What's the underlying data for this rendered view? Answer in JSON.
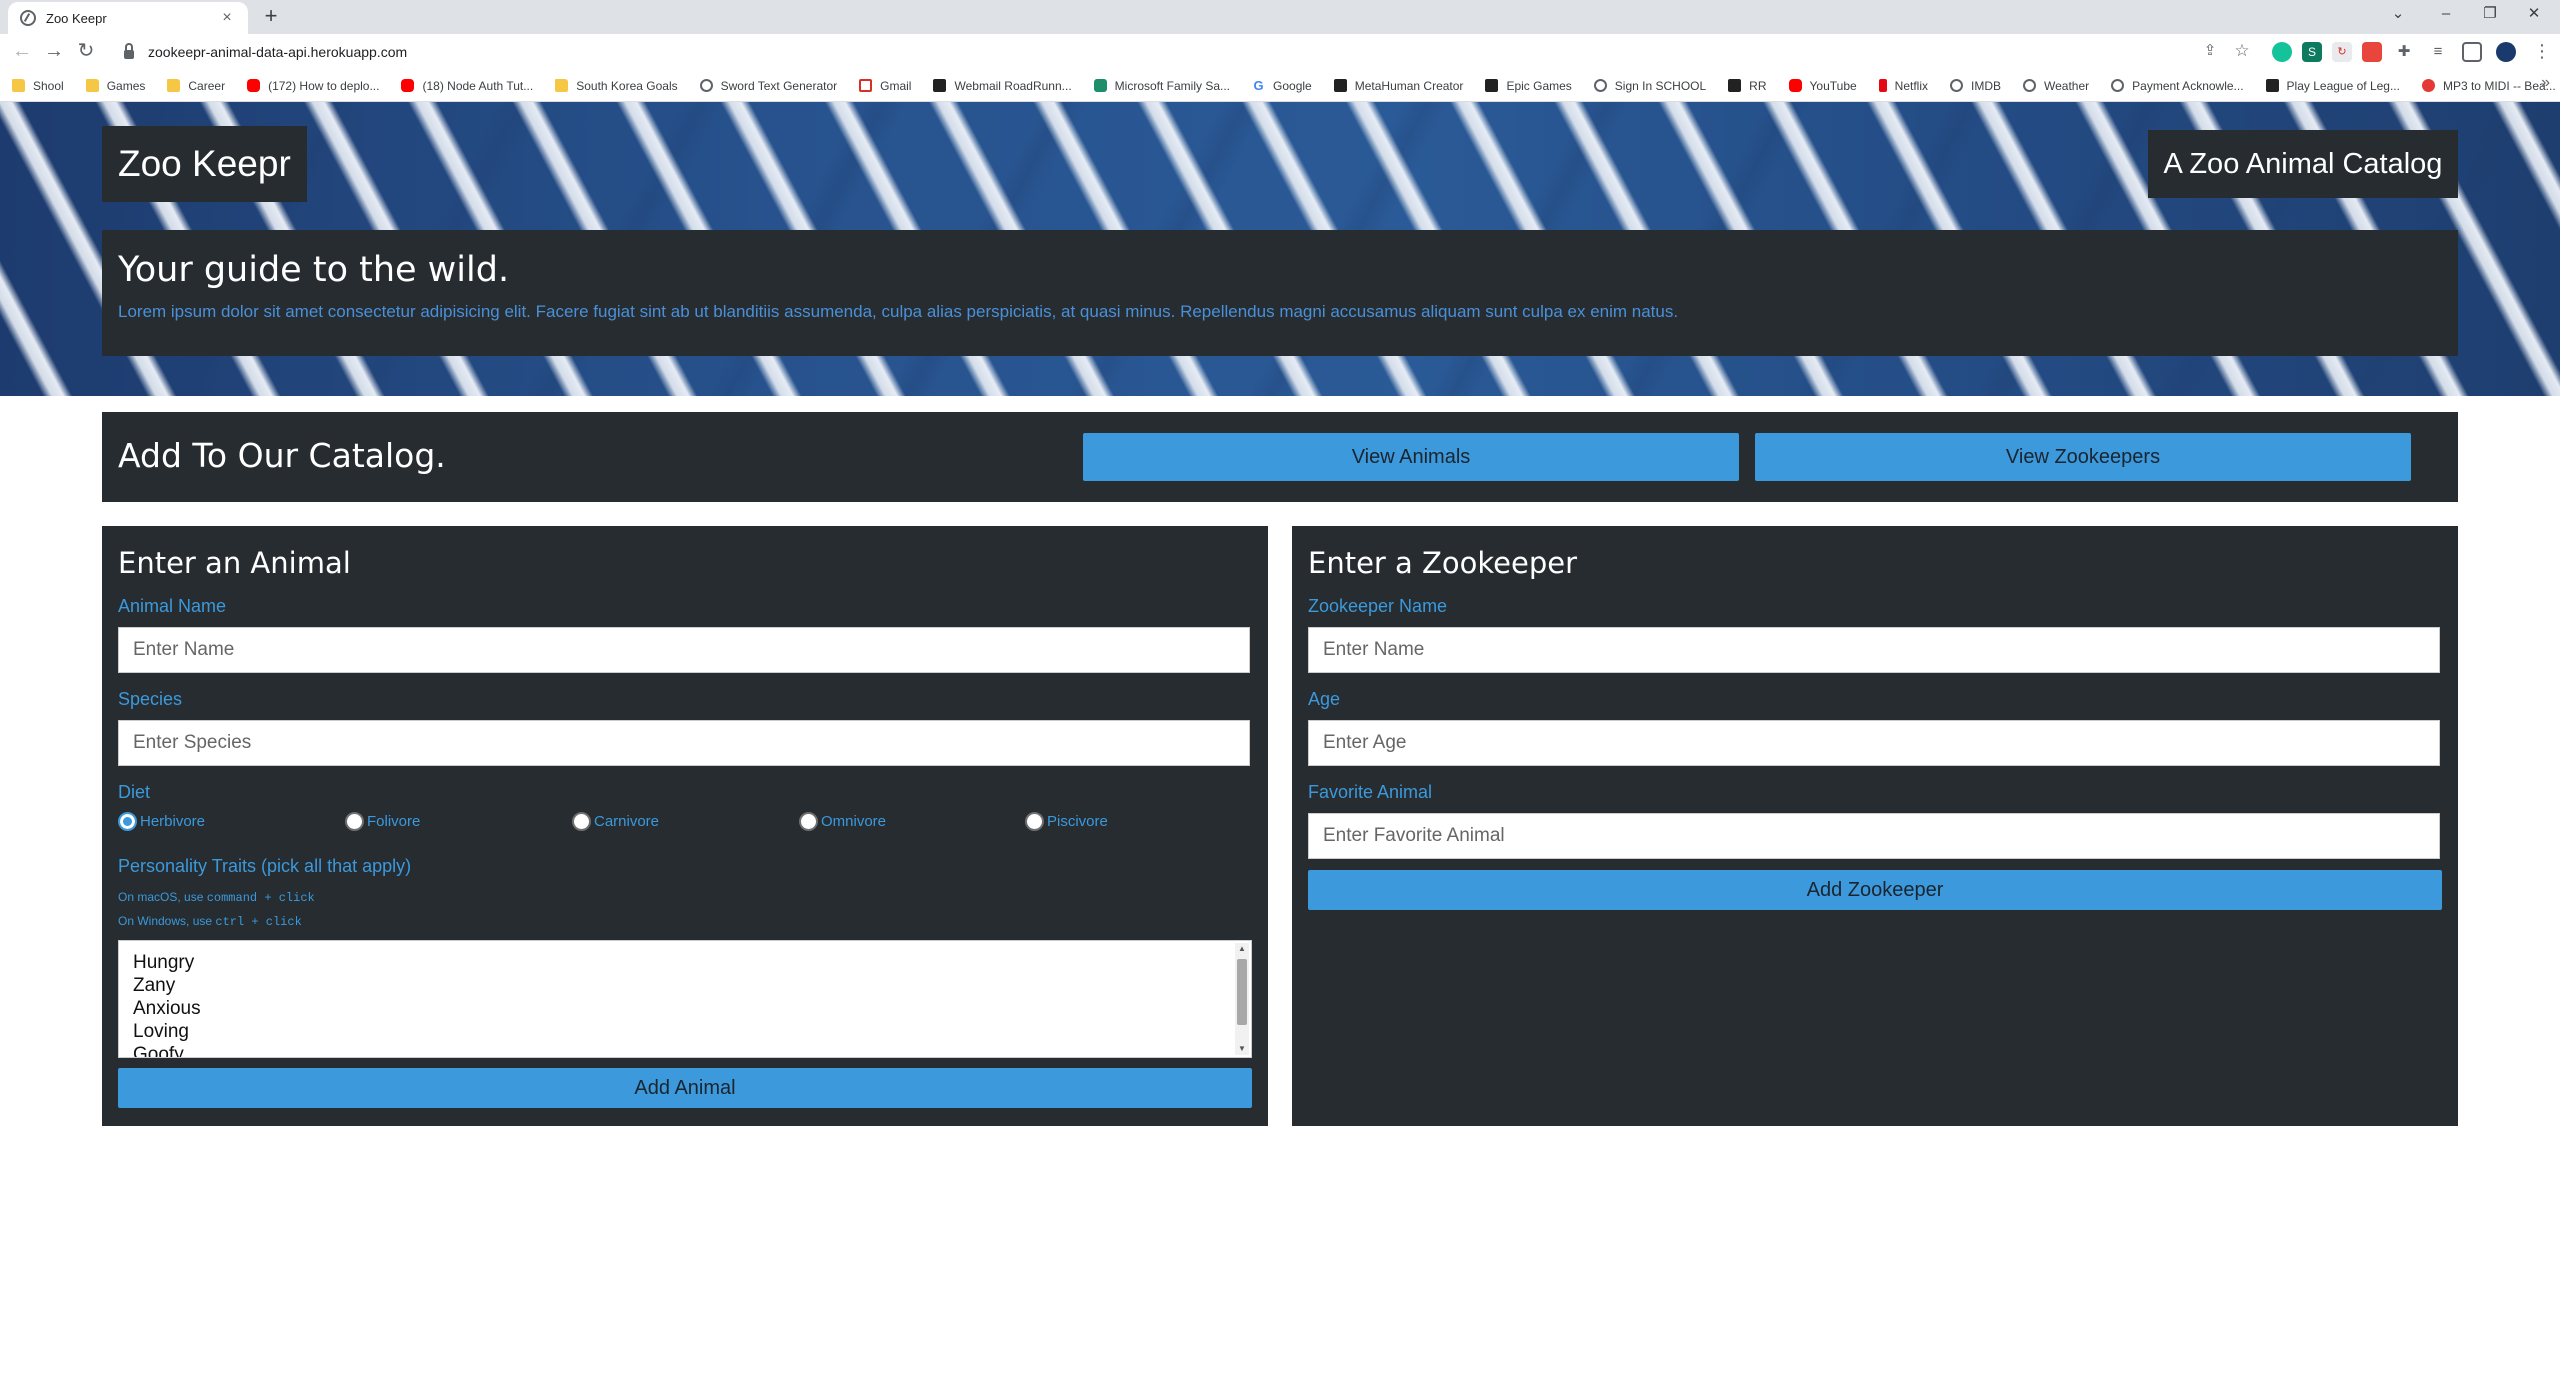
{
  "browser": {
    "tab_title": "Zoo Keepr",
    "tab_close": "×",
    "new_tab": "+",
    "url": "zookeepr-animal-data-api.herokuapp.com",
    "window_controls": [
      "⌄",
      "–",
      "❐",
      "✕"
    ],
    "bookmarks": [
      {
        "label": "Shool",
        "icon": "folder"
      },
      {
        "label": "Games",
        "icon": "folder"
      },
      {
        "label": "Career",
        "icon": "folder"
      },
      {
        "label": "(172) How to deplo...",
        "icon": "youtube"
      },
      {
        "label": "(18) Node Auth Tut...",
        "icon": "youtube"
      },
      {
        "label": "South Korea Goals",
        "icon": "folder"
      },
      {
        "label": "Sword Text Generator",
        "icon": "sword"
      },
      {
        "label": "Gmail",
        "icon": "gmail"
      },
      {
        "label": "Webmail RoadRunn...",
        "icon": "dark"
      },
      {
        "label": "Microsoft Family Sa...",
        "icon": "heart"
      },
      {
        "label": "Google",
        "icon": "google"
      },
      {
        "label": "MetaHuman Creator",
        "icon": "dark"
      },
      {
        "label": "Epic Games",
        "icon": "dark"
      },
      {
        "label": "Sign In SCHOOL",
        "icon": "globe"
      },
      {
        "label": "RR",
        "icon": "dark"
      },
      {
        "label": "YouTube",
        "icon": "youtube"
      },
      {
        "label": "Netflix",
        "icon": "netflix"
      },
      {
        "label": "IMDB",
        "icon": "globe"
      },
      {
        "label": "Weather",
        "icon": "globe"
      },
      {
        "label": "Payment Acknowle...",
        "icon": "globe"
      },
      {
        "label": "Play League of Leg...",
        "icon": "dark"
      },
      {
        "label": "MP3 to MIDI -- Bea...",
        "icon": "red"
      }
    ],
    "bookmarks_more": "»"
  },
  "header": {
    "brand": "Zoo Keepr",
    "badge": "A Zoo Animal Catalog",
    "guide_title": "Your guide to the wild.",
    "guide_text": "Lorem ipsum dolor sit amet consectetur adipisicing elit. Facere fugiat sint ab ut blanditiis assumenda, culpa alias perspiciatis, at quasi minus. Repellendus magni accusamus aliquam sunt culpa ex enim natus."
  },
  "catalog": {
    "title": "Add To Our Catalog.",
    "view_animals": "View Animals",
    "view_zookeepers": "View Zookeepers"
  },
  "animal_form": {
    "title": "Enter an Animal",
    "name_label": "Animal Name",
    "name_placeholder": "Enter Name",
    "species_label": "Species",
    "species_placeholder": "Enter Species",
    "diet_label": "Diet",
    "diet_options": [
      "Herbivore",
      "Folivore",
      "Carnivore",
      "Omnivore",
      "Piscivore"
    ],
    "diet_selected": "Herbivore",
    "traits_label": "Personality Traits (pick all that apply)",
    "hint_mac_prefix": "On macOS, use ",
    "hint_mac_code": "command + click",
    "hint_win_prefix": "On Windows, use ",
    "hint_win_code": "ctrl + click",
    "traits": [
      "Hungry",
      "Zany",
      "Anxious",
      "Loving",
      "Goofy"
    ],
    "submit": "Add Animal"
  },
  "zookeeper_form": {
    "title": "Enter a Zookeeper",
    "name_label": "Zookeeper Name",
    "name_placeholder": "Enter Name",
    "age_label": "Age",
    "age_placeholder": "Enter Age",
    "fav_label": "Favorite Animal",
    "fav_placeholder": "Enter Favorite Animal",
    "submit": "Add Zookeeper"
  },
  "colors": {
    "panel": "#262c30",
    "accent": "#3b99dc",
    "hero_blue": "#27528d"
  }
}
